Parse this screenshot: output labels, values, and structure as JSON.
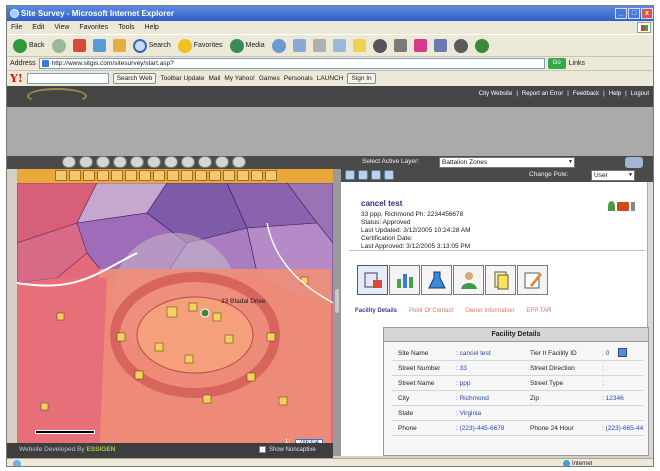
{
  "window": {
    "title": "Site Survey - Microsoft Internet Explorer",
    "buttons": [
      "_",
      "□",
      "x"
    ]
  },
  "menu": [
    "File",
    "Edit",
    "View",
    "Favorites",
    "Tools",
    "Help"
  ],
  "toolbar": {
    "back": "Back",
    "search": "Search",
    "favorites": "Favorites",
    "media": "Media"
  },
  "address": {
    "label": "Address",
    "url": "http://www.sitgis.com/sitesurvey/start.asp?",
    "go": "Go",
    "links": "Links"
  },
  "yahoo": {
    "logo": "Y!",
    "search_button": "Search Web",
    "toolbar_update": "Toolbar Update",
    "mail": "Mail",
    "my_yahoo": "My Yahoo!",
    "games": "Games",
    "personals": "Personals",
    "launch": "LAUNCH",
    "sign_in": "Sign In"
  },
  "site_links": [
    "City Website",
    "Report an Error",
    "Feedback",
    "Help",
    "Logout"
  ],
  "map": {
    "layer_label": "Select Active Layer:",
    "layer_value": "Battalion Zones",
    "address_label": "33 Bfadal Drive",
    "coord_value": "286304",
    "coord_label": "1:",
    "developed_by": "Website Developed By",
    "developer": "ESSIGEN",
    "show_noncat": "Show Noncaptive"
  },
  "facility": {
    "change_label": "Change Pole:",
    "change_value": "User",
    "title": "cancel test",
    "address_line": "33 ppp, Richmond Ph: 2234456678",
    "status": "Status: Approved",
    "last_updated": "Last Updated: 3/12/2005 10:24:28 AM",
    "cert_date": "Certification Date:",
    "last_approved": "Last Approved: 3/12/2005 3:13:05 PM"
  },
  "subtabs": [
    "Facility Details",
    "Point Of Contact",
    "Owner Information",
    "EPP TAR"
  ],
  "details": {
    "header": "Facility Details",
    "rows": [
      {
        "l1": "Site Name",
        "v1": ": cancel test",
        "l2": "Tier II Facility ID",
        "v2": ": 0"
      },
      {
        "l1": "Street Number",
        "v1": ": 33",
        "l2": "Street Direction",
        "v2": ":"
      },
      {
        "l1": "Street Name",
        "v1": ": ppp",
        "l2": "Street Type",
        "v2": ":"
      },
      {
        "l1": "City",
        "v1": ": Richmond",
        "l2": "Zip",
        "v2": ": 12346"
      },
      {
        "l1": "State",
        "v1": ": Virginia",
        "l2": "",
        "v2": ""
      },
      {
        "l1": "Phone",
        "v1": ": (223)-445-6678",
        "l2": "Phone 24 Hour",
        "v2": ": (223)-665-44"
      }
    ]
  },
  "status": {
    "zone": "Internet"
  }
}
